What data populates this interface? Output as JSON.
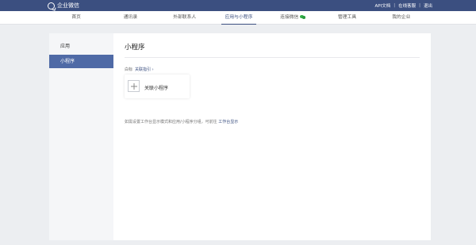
{
  "header": {
    "brand": "企业微信",
    "links": [
      "API文档",
      "在线客服",
      "退出"
    ]
  },
  "nav": {
    "items": [
      "首页",
      "通讯录",
      "外部联系人",
      "应用与小程序",
      "连接微信",
      "管理工具",
      "我的企业"
    ],
    "active_index": 3,
    "wechat_icon": "wechat-icon"
  },
  "sidebar": {
    "title": "应用",
    "items": [
      "小程序"
    ]
  },
  "main": {
    "title": "小程序",
    "guide_prefix": "白标",
    "guide_link": "关联指引 ›",
    "add_label": "关联小程序",
    "note_text": "如需设置工作台显示模式和应用/小程序分组，可前往",
    "note_link": "工作台显示"
  },
  "colors": {
    "header_bg": "#3b4f80",
    "accent": "#4f6aa6"
  }
}
